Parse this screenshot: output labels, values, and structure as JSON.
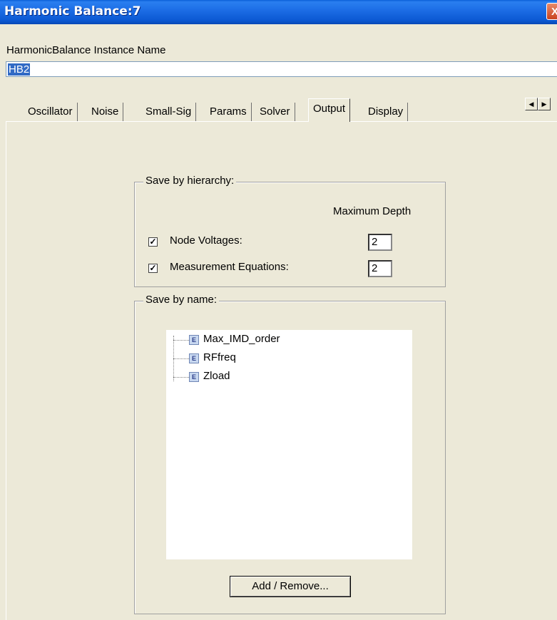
{
  "window": {
    "title": "Harmonic Balance:7",
    "close_glyph": "X"
  },
  "instance": {
    "label": "HarmonicBalance Instance Name",
    "value": "HB2"
  },
  "tabs": [
    {
      "label": "Oscillator"
    },
    {
      "label": "Noise"
    },
    {
      "label": "Small-Sig"
    },
    {
      "label": "Params"
    },
    {
      "label": "Solver"
    },
    {
      "label": "Output"
    },
    {
      "label": "Display"
    }
  ],
  "active_tab": "Output",
  "tab_scroll": {
    "left_icon": "arrow-left-icon",
    "right_icon": "arrow-right-icon"
  },
  "hierarchy": {
    "legend": "Save by hierarchy:",
    "depth_header": "Maximum Depth",
    "rows": [
      {
        "label": "Node Voltages:",
        "checked": true,
        "depth": "2"
      },
      {
        "label": "Measurement Equations:",
        "checked": true,
        "depth": "2"
      }
    ]
  },
  "by_name": {
    "legend": "Save by name:",
    "items": [
      {
        "label": "Max_IMD_order",
        "icon": "equation-icon"
      },
      {
        "label": "RFfreq",
        "icon": "equation-icon"
      },
      {
        "label": "Zload",
        "icon": "equation-icon"
      }
    ],
    "add_remove_label": "Add / Remove..."
  },
  "colors": {
    "title_bar": "#0a5fd8",
    "selection": "#316ac5",
    "dialog_bg": "#ece9d8"
  }
}
